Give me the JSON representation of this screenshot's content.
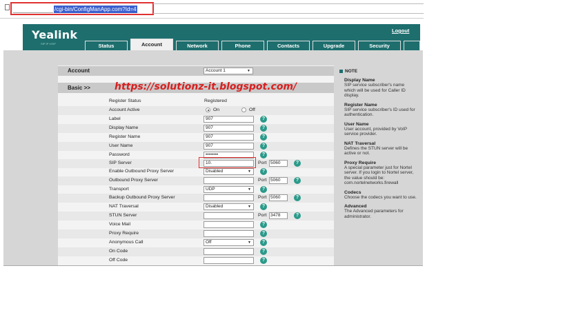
{
  "browser": {
    "address_text": "/cgi-bin/ConfigManApp.com?Id=4"
  },
  "header": {
    "brand": "Yealink",
    "brand_sub": "SIP IP VOIP",
    "logout": "Logout",
    "tabs": [
      {
        "label": "Status",
        "active": false
      },
      {
        "label": "Account",
        "active": true
      },
      {
        "label": "Network",
        "active": false
      },
      {
        "label": "Phone",
        "active": false
      },
      {
        "label": "Contacts",
        "active": false
      },
      {
        "label": "Upgrade",
        "active": false
      },
      {
        "label": "Security",
        "active": false
      }
    ]
  },
  "account": {
    "section_label": "Account",
    "selected_account": "Account 1",
    "basic_label": "Basic >>"
  },
  "watermark": "https://solutionz-it.blogspot.com/",
  "form": {
    "register_status": {
      "label": "Register Status",
      "value": "Registered"
    },
    "account_active": {
      "label": "Account Active",
      "on": "On",
      "off": "Off",
      "selected": "On"
    },
    "label": {
      "label": "Label",
      "value": "907"
    },
    "display_name": {
      "label": "Display Name",
      "value": "907"
    },
    "register_name": {
      "label": "Register Name",
      "value": "907"
    },
    "user_name": {
      "label": "User Name",
      "value": "907"
    },
    "password": {
      "label": "Password",
      "value": "••••••••"
    },
    "sip_server": {
      "label": "SIP Server",
      "value": "10.",
      "port_label": "Port",
      "port": "5060"
    },
    "enable_outbound_proxy": {
      "label": "Enable Outbound Proxy Server",
      "value": "Disabled"
    },
    "outbound_proxy": {
      "label": "Outbound Proxy Server",
      "value": "",
      "port_label": "Port",
      "port": "5060"
    },
    "transport": {
      "label": "Transport",
      "value": "UDP"
    },
    "backup_outbound_proxy": {
      "label": "Backup Outbound Proxy Server",
      "value": "",
      "port_label": "Port",
      "port": "5060"
    },
    "nat_traversal": {
      "label": "NAT Traversal",
      "value": "Disabled"
    },
    "stun_server": {
      "label": "STUN Server",
      "value": "",
      "port_label": "Port",
      "port": "3478"
    },
    "voice_mail": {
      "label": "Voice Mail",
      "value": ""
    },
    "proxy_require": {
      "label": "Proxy Require",
      "value": ""
    },
    "anonymous_call": {
      "label": "Anonymous Call",
      "value": "Off"
    },
    "on_code": {
      "label": "On Code",
      "value": ""
    },
    "off_code": {
      "label": "Off Code",
      "value": ""
    }
  },
  "note": {
    "title": "NOTE",
    "items": [
      {
        "heading": "Display Name",
        "text": "SIP service subscriber's name which will be used for Caller ID display."
      },
      {
        "heading": "Register Name",
        "text": "SIP service subscriber's ID used for authentication."
      },
      {
        "heading": "User Name",
        "text": "User account, provided by VoIP service provider."
      },
      {
        "heading": "NAT Traversal",
        "text": "Defines the STUN server will be active or not."
      },
      {
        "heading": "Proxy Require",
        "text": "A special parameter just for Nortel server. If you login to Nortel server, the value should be: com.nortelnetworks.firewall"
      },
      {
        "heading": "Codecs",
        "text": "Choose the codecs you want to use."
      },
      {
        "heading": "Advanced",
        "text": "The Advanced parameters for administrator."
      }
    ]
  },
  "colors": {
    "brand_teal": "#1e6e6e",
    "help_icon": "#2a9a8a",
    "annotation_red": "#e03030",
    "watermark_red": "#d81f1f"
  }
}
